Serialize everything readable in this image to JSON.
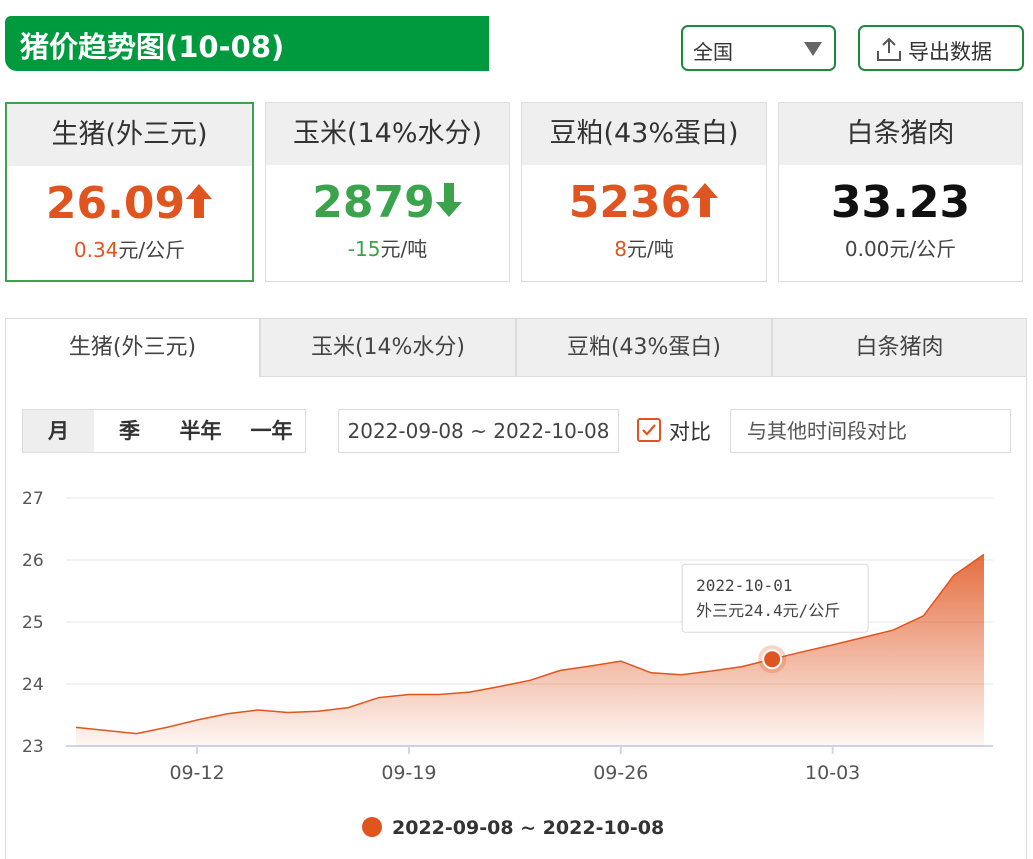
{
  "header": {
    "title": "猪价趋势图(10-08)",
    "region": "全国",
    "export_label": "导出数据"
  },
  "cards": [
    {
      "name": "生猪(外三元)",
      "price": "26.09",
      "change_value": "0.34",
      "change_unit": "元/公斤",
      "direction": "up"
    },
    {
      "name": "玉米(14%水分)",
      "price": "2879",
      "change_value": "-15",
      "change_unit": "元/吨",
      "direction": "down"
    },
    {
      "name": "豆粕(43%蛋白)",
      "price": "5236",
      "change_value": "8",
      "change_unit": "元/吨",
      "direction": "up"
    },
    {
      "name": "白条猪肉",
      "price": "33.23",
      "change_value": "0.00",
      "change_unit": "元/公斤",
      "direction": "flat"
    }
  ],
  "tabs": [
    "生猪(外三元)",
    "玉米(14%水分)",
    "豆粕(43%蛋白)",
    "白条猪肉"
  ],
  "controls": {
    "periods": [
      "月",
      "季",
      "半年",
      "一年"
    ],
    "date_range": "2022-09-08 ~ 2022-10-08",
    "compare_label": "对比",
    "compare_placeholder": "与其他时间段对比"
  },
  "colors": {
    "brand_green": "#009a3e",
    "up": "#e0551f",
    "down": "#3aa34c",
    "series": "#e0551f"
  },
  "chart_data": {
    "type": "area",
    "x": [
      "2022-09-08",
      "2022-09-09",
      "2022-09-10",
      "2022-09-11",
      "2022-09-12",
      "2022-09-13",
      "2022-09-14",
      "2022-09-15",
      "2022-09-16",
      "2022-09-17",
      "2022-09-18",
      "2022-09-19",
      "2022-09-20",
      "2022-09-21",
      "2022-09-22",
      "2022-09-23",
      "2022-09-24",
      "2022-09-25",
      "2022-09-26",
      "2022-09-27",
      "2022-09-28",
      "2022-09-29",
      "2022-09-30",
      "2022-10-01",
      "2022-10-02",
      "2022-10-03",
      "2022-10-04",
      "2022-10-05",
      "2022-10-06",
      "2022-10-07",
      "2022-10-08"
    ],
    "xticks": [
      "09-12",
      "09-19",
      "09-26",
      "10-03"
    ],
    "yticks": [
      23,
      24,
      25,
      26,
      27
    ],
    "ylim": [
      23,
      27
    ],
    "series": [
      {
        "name": "2022-09-08 ~ 2022-10-08",
        "values": [
          23.3,
          23.25,
          23.2,
          23.3,
          23.42,
          23.52,
          23.58,
          23.54,
          23.56,
          23.62,
          23.78,
          23.83,
          23.83,
          23.87,
          23.96,
          24.06,
          24.22,
          24.29,
          24.37,
          24.18,
          24.15,
          24.21,
          24.28,
          24.4,
          24.52,
          24.63,
          24.75,
          24.87,
          25.1,
          25.75,
          26.09
        ]
      }
    ],
    "tooltip": {
      "date": "2022-10-01",
      "text": "外三元24.4元/公斤",
      "index": 23
    },
    "legend": {
      "label": "2022-09-08 ~ 2022-10-08",
      "position": "bottom-center"
    },
    "grid": true
  }
}
